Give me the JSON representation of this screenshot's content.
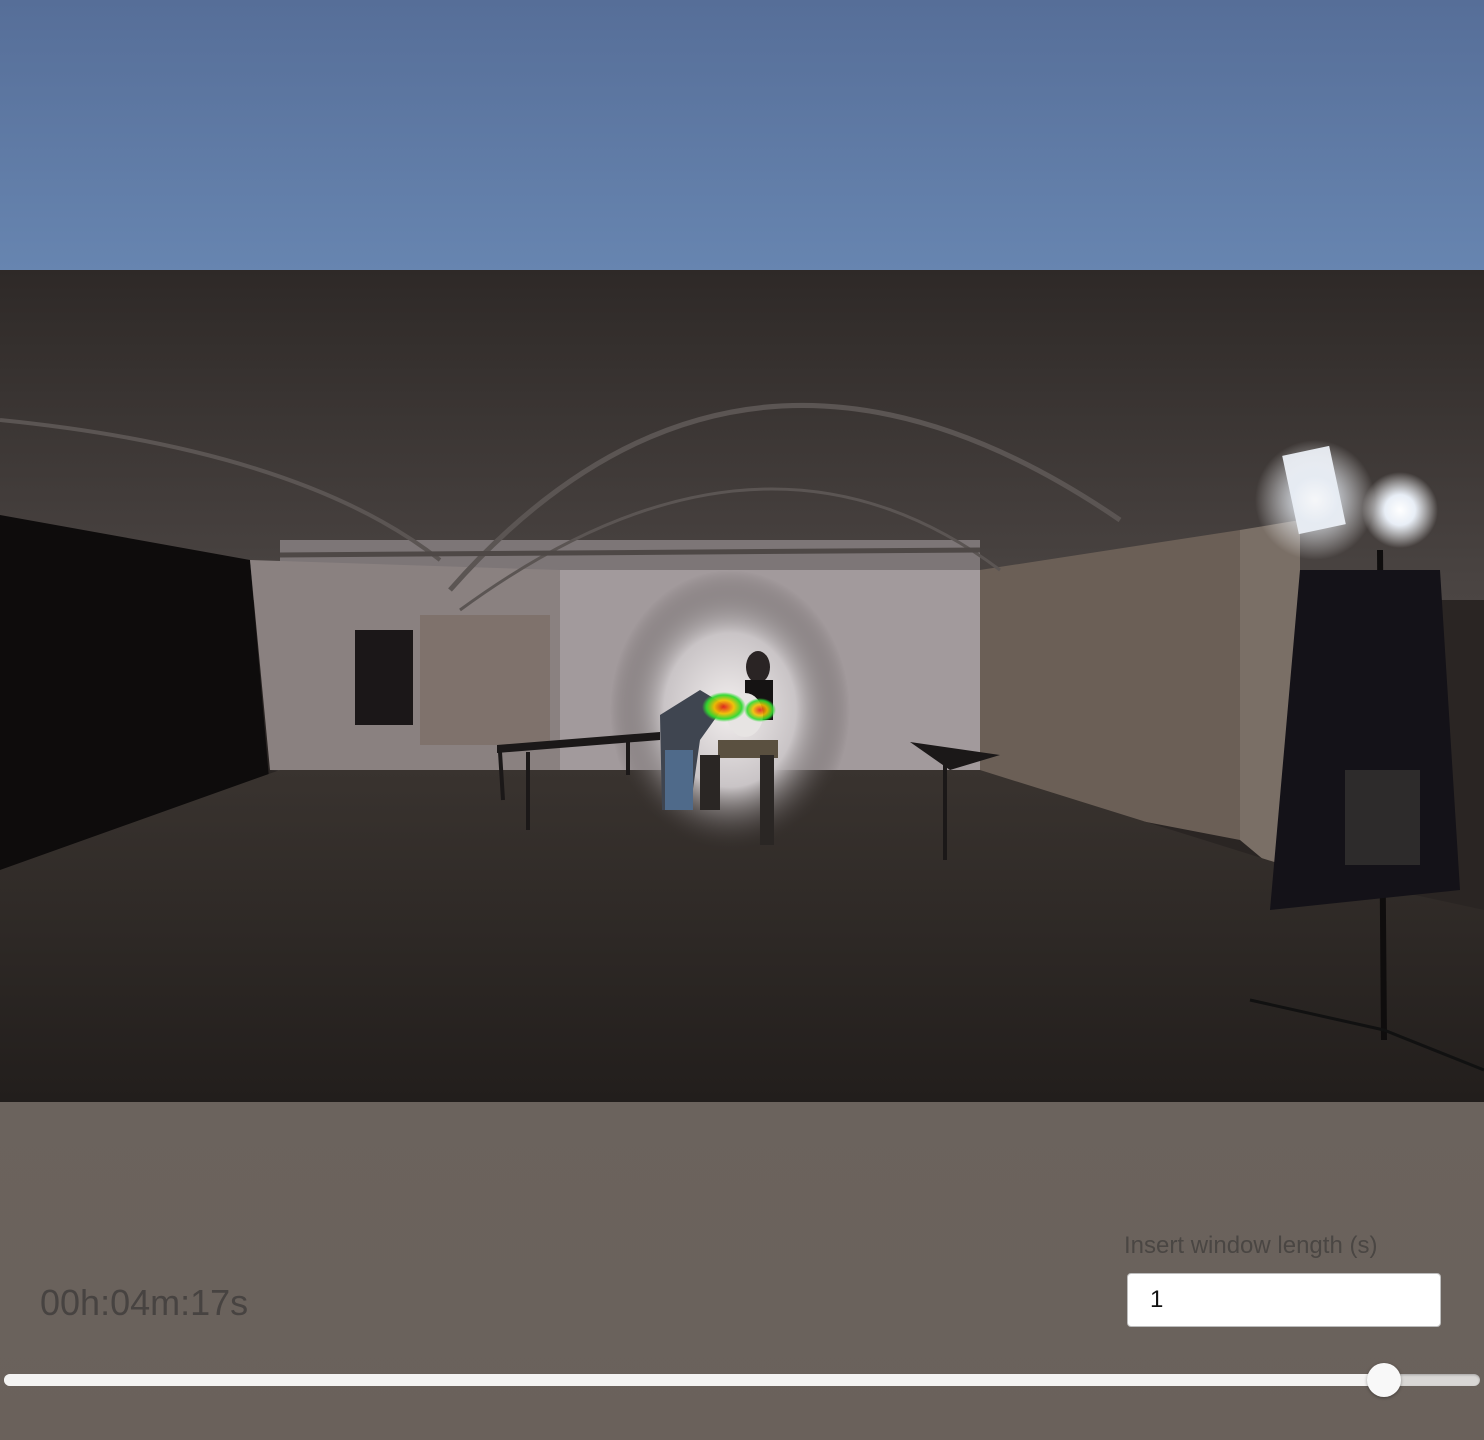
{
  "player": {
    "timestamp": "00h:04m:17s",
    "progress_fraction": 0.935
  },
  "window_length": {
    "label": "Insert window length (s)",
    "value": "1"
  },
  "colors": {
    "sky": "#6785b0",
    "background": "#6a625c",
    "slider_fill": "#f4f3f2"
  }
}
